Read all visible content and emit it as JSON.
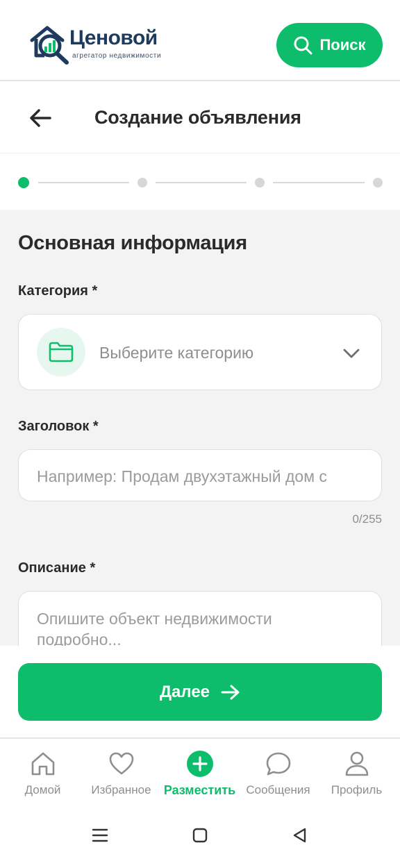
{
  "header": {
    "logo_title": "Ценовой",
    "logo_subtitle": "агрегатор недвижимости",
    "search_label": "Поиск"
  },
  "titlebar": {
    "title": "Создание объявления"
  },
  "stepper": {
    "total_steps": 4,
    "current_step": 1
  },
  "form": {
    "section_title": "Основная информация",
    "category": {
      "label": "Категория *",
      "placeholder": "Выберите категорию"
    },
    "title": {
      "label": "Заголовок *",
      "placeholder": "Например: Продам двухэтажный дом с",
      "counter": "0/255"
    },
    "description": {
      "label": "Описание *",
      "placeholder": "Опишите объект недвижимости подробно..."
    }
  },
  "footer": {
    "next_label": "Далее"
  },
  "tabbar": {
    "items": [
      {
        "label": "Домой",
        "icon": "home-icon",
        "active": false
      },
      {
        "label": "Избранное",
        "icon": "heart-icon",
        "active": false
      },
      {
        "label": "Разместить",
        "icon": "plus-circle-icon",
        "active": true
      },
      {
        "label": "Сообщения",
        "icon": "chat-icon",
        "active": false
      },
      {
        "label": "Профиль",
        "icon": "user-icon",
        "active": false
      }
    ]
  },
  "colors": {
    "accent": "#0dbd6b",
    "brand_dark": "#1e3a5c",
    "background": "#f3f3f3"
  }
}
